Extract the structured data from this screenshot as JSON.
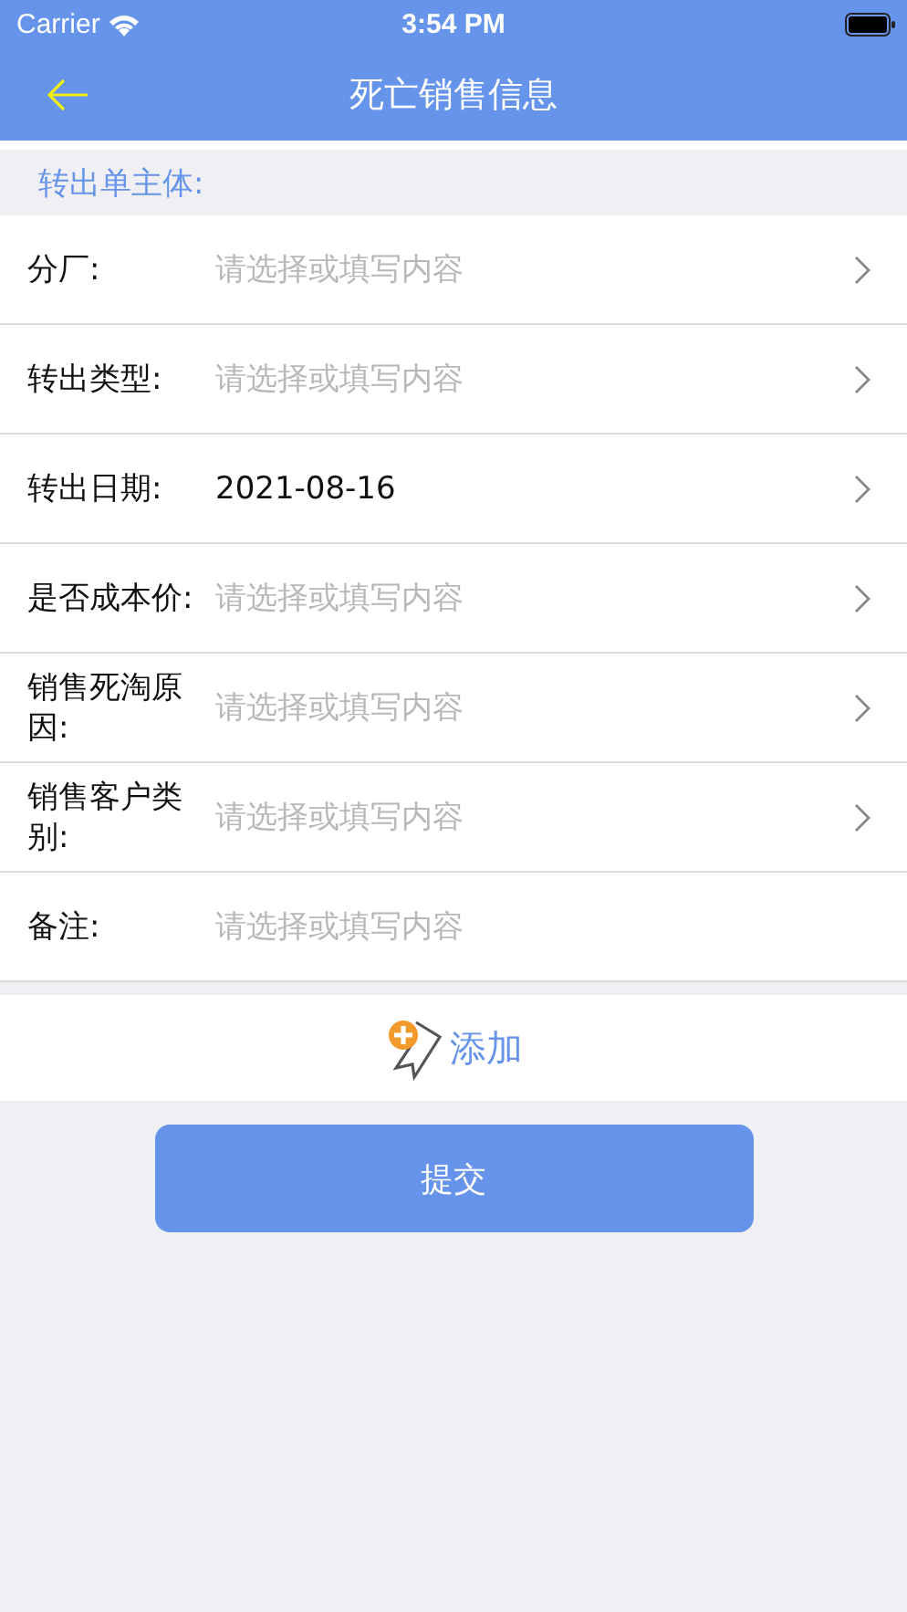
{
  "status_bar": {
    "carrier": "Carrier",
    "time": "3:54 PM"
  },
  "nav": {
    "title": "死亡销售信息"
  },
  "section": {
    "title": "转出单主体:"
  },
  "fields": [
    {
      "label": "分厂:",
      "placeholder": "请选择或填写内容",
      "disclosure": true
    },
    {
      "label": "转出类型:",
      "placeholder": "请选择或填写内容",
      "disclosure": true
    },
    {
      "label": "转出日期:",
      "value": "2021-08-16",
      "disclosure": true
    },
    {
      "label": "是否成本价:",
      "placeholder": "请选择或填写内容",
      "disclosure": true
    },
    {
      "label": "销售死淘原因:",
      "placeholder": "请选择或填写内容",
      "disclosure": true
    },
    {
      "label": "销售客户类别:",
      "placeholder": "请选择或填写内容",
      "disclosure": true
    },
    {
      "label": "备注:",
      "placeholder": "请选择或填写内容",
      "disclosure": false
    }
  ],
  "add_button": {
    "label": "添加"
  },
  "submit_button": {
    "label": "提交"
  }
}
